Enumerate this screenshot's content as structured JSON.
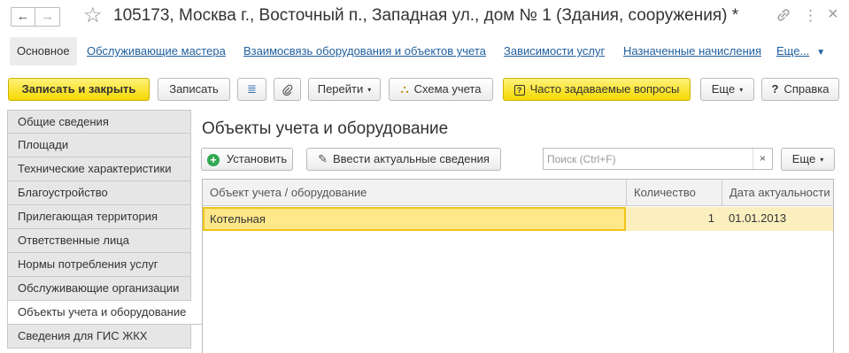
{
  "window": {
    "title": "105173, Москва г., Восточный п., Западная ул., дом № 1 (Здания, сооружения) *",
    "back_icon": "←",
    "forward_icon": "→",
    "favorite_icon": "☆",
    "link_icon": "🔗",
    "more_icon": "⋮",
    "close_icon": "×"
  },
  "tabs": {
    "items": [
      "Основное",
      "Обслуживающие мастера",
      "Взаимосвязь оборудования и объектов учета",
      "Зависимости услуг",
      "Назначенные начисления",
      "Еще..."
    ],
    "more_arrow": "▼"
  },
  "toolbar": {
    "save_close": "Записать и закрыть",
    "save": "Записать",
    "list_icon": "≣",
    "attach_icon": "📎",
    "goto": "Перейти",
    "dropdown_arrow": "▾",
    "scheme_icon": "⛬",
    "scheme": "Схема учета",
    "faq_icon": "?",
    "faq": "Часто задаваемые вопросы",
    "more": "Еще",
    "help_icon": "?",
    "help": "Справка"
  },
  "sidebar": {
    "items": [
      "Общие сведения",
      "Площади",
      "Технические характеристики",
      "Благоустройство",
      "Прилегающая территория",
      "Ответственные лица",
      "Нормы потребления услуг",
      "Обслуживающие организации",
      "Объекты учета и оборудование",
      "Сведения для ГИС ЖКХ"
    ],
    "active_index": 8
  },
  "panel": {
    "title": "Объекты учета и оборудование",
    "install_icon": "+",
    "install": "Установить",
    "actual_icon": "✎",
    "actual": "Ввести актуальные сведения",
    "search_placeholder": "Поиск (Ctrl+F)",
    "search_value": "",
    "clear_icon": "×",
    "more": "Еще",
    "dropdown_arrow": "▾"
  },
  "table": {
    "columns": [
      "Объект учета / оборудование",
      "Количество",
      "Дата актуальности"
    ],
    "rows": [
      [
        "Котельная",
        "1",
        "01.01.2013"
      ]
    ]
  },
  "colors": {
    "accent_yellow": "#f5d800",
    "link_blue": "#1f5f9e",
    "selected_row": "#fbefbf",
    "selected_cell_border": "#f0c419",
    "install_green": "#2fa84f"
  }
}
